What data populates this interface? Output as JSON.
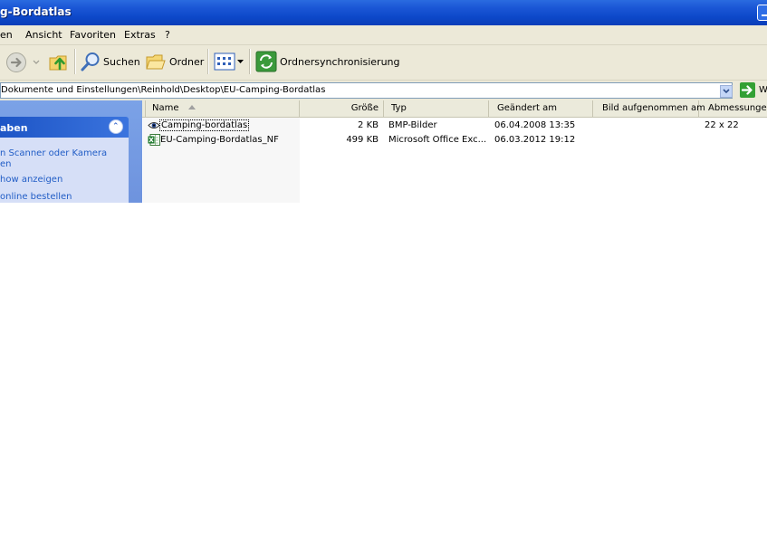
{
  "window": {
    "title": "g-Bordatlas"
  },
  "menu": {
    "items": [
      "en",
      "Ansicht",
      "Favoriten",
      "Extras",
      "?"
    ]
  },
  "toolbar": {
    "search_label": "Suchen",
    "folders_label": "Ordner",
    "sync_label": "Ordnersynchronisierung"
  },
  "address": {
    "path": "Dokumente und Einstellungen\\Reinhold\\Desktop\\EU-Camping-Bordatlas",
    "go_label": "W"
  },
  "taskpane": {
    "header": "aben",
    "links": [
      "n Scanner oder Kamera",
      "en",
      "how anzeigen",
      "online bestellen"
    ]
  },
  "columns": {
    "name": "Name",
    "size": "Größe",
    "type": "Typ",
    "modified": "Geändert am",
    "taken": "Bild aufgenommen am",
    "dimensions": "Abmessungen"
  },
  "files": [
    {
      "name": "Camping-bordatlas",
      "size": "2 KB",
      "type": "BMP-Bilder",
      "modified": "06.04.2008 13:35",
      "taken": "",
      "dimensions": "22 x 22",
      "icon": "bitmap-image-icon"
    },
    {
      "name": "EU-Camping-Bordatlas_NF",
      "size": "499 KB",
      "type": "Microsoft Office Exc...",
      "modified": "06.03.2012 19:12",
      "taken": "",
      "dimensions": "",
      "icon": "excel-file-icon"
    }
  ]
}
